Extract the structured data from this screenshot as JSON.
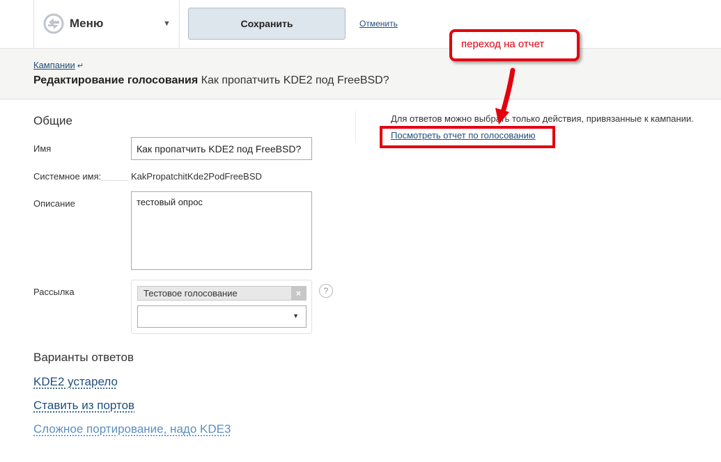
{
  "topbar": {
    "menu_label": "Меню",
    "save_label": "Сохранить",
    "cancel_label": "Отменить"
  },
  "header": {
    "breadcrumb": "Кампании",
    "title_bold": "Редактирование голосования",
    "title_rest": "Как пропатчить KDE2 под FreeBSD?"
  },
  "general": {
    "section_title": "Общие",
    "name_label": "Имя",
    "name_value": "Как пропатчить KDE2 под FreeBSD?",
    "system_name_label": "Системное имя:",
    "system_name_value": "KakPropatchitKde2PodFreeBSD",
    "description_label": "Описание",
    "description_value": "тестовый опрос",
    "mailing_label": "Рассылка",
    "mailing_tag": "Тестовое голосование",
    "mailing_tag_remove": "×",
    "help_icon": "?"
  },
  "answers": {
    "section_title": "Варианты ответов",
    "items": [
      "KDE2 устарело",
      "Ставить из портов",
      "Сложное портирование, надо KDE3"
    ]
  },
  "right": {
    "info_text": "Для ответов можно выбрать только действия, привязанные к кампании.",
    "report_link": "Посмотреть отчет по голосованию"
  },
  "annotation": {
    "callout_text": "переход на отчет",
    "color": "#e3000f"
  },
  "colors": {
    "link": "#1f4e79",
    "save_button_bg": "#dde5ed"
  }
}
